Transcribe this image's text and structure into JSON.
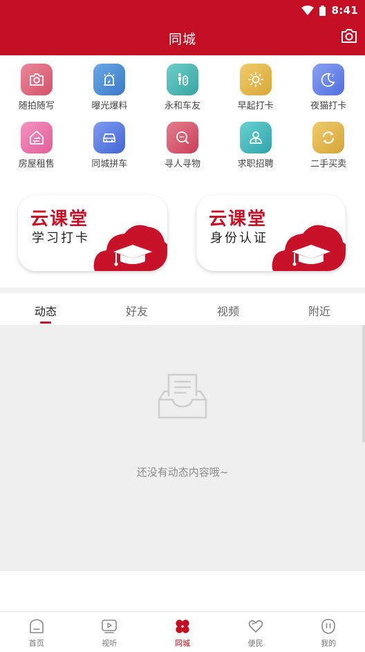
{
  "status_bar": {
    "time": "8:41",
    "wifi_icon": "wifi-icon",
    "battery_icon": "battery-icon"
  },
  "header": {
    "title": "同城",
    "camera_icon": "camera-icon"
  },
  "features": {
    "row1": [
      {
        "label": "随拍随写",
        "icon": "camera-icon",
        "color": "#e0677c"
      },
      {
        "label": "曝光爆料",
        "icon": "alarm-icon",
        "color": "#4a8fd4"
      },
      {
        "label": "永和车友",
        "icon": "traffic-icon",
        "color": "#49b7b2"
      },
      {
        "label": "早起打卡",
        "icon": "sun-icon",
        "color": "#e5b94a"
      },
      {
        "label": "夜猫打卡",
        "icon": "moon-icon",
        "color": "#6180e8"
      }
    ],
    "row2": [
      {
        "label": "房屋租售",
        "icon": "house-swap-icon",
        "color": "#ec72a8"
      },
      {
        "label": "同城拼车",
        "icon": "car-icon",
        "color": "#5b7fe3"
      },
      {
        "label": "寻人寻物",
        "icon": "search-chat-icon",
        "color": "#d9566b"
      },
      {
        "label": "求职招聘",
        "icon": "person-icon",
        "color": "#43b8bc"
      },
      {
        "label": "二手买卖",
        "icon": "recycle-icon",
        "color": "#e2b347"
      }
    ]
  },
  "cards": [
    {
      "title": "云课堂",
      "subtitle": "学习打卡"
    },
    {
      "title": "云课堂",
      "subtitle": "身份认证"
    }
  ],
  "tabs": [
    {
      "label": "动态",
      "active": true
    },
    {
      "label": "好友",
      "active": false
    },
    {
      "label": "视频",
      "active": false
    },
    {
      "label": "附近",
      "active": false
    }
  ],
  "empty": {
    "message": "还没有动态内容哦~",
    "icon": "empty-inbox-icon"
  },
  "bottom_nav": [
    {
      "label": "首页",
      "icon": "home-icon",
      "active": false
    },
    {
      "label": "视听",
      "icon": "video-icon",
      "active": false
    },
    {
      "label": "同城",
      "icon": "clover-icon",
      "active": true
    },
    {
      "label": "便民",
      "icon": "heart-icon",
      "active": false
    },
    {
      "label": "我的",
      "icon": "profile-icon",
      "active": false
    }
  ],
  "colors": {
    "brand": "#c30e23",
    "background": "#efefef"
  }
}
